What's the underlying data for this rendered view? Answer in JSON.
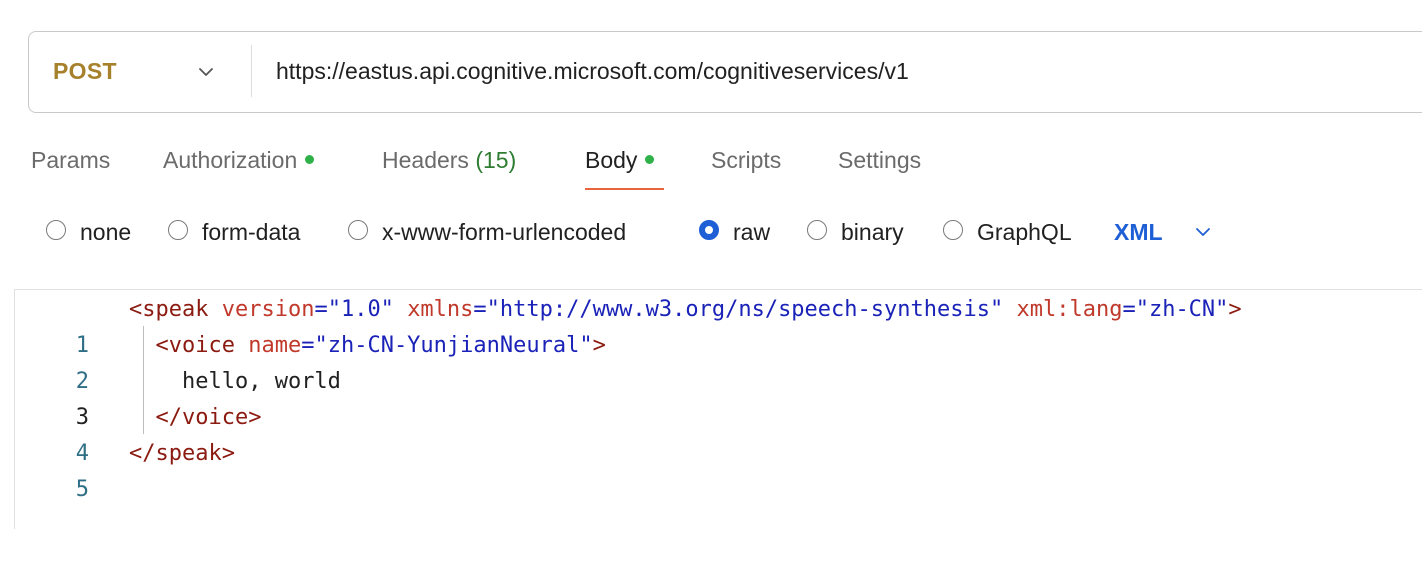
{
  "request": {
    "method": "POST",
    "url": "https://eastus.api.cognitive.microsoft.com/cognitiveservices/v1"
  },
  "tabs": [
    {
      "label": "Params"
    },
    {
      "label": "Authorization",
      "dot": true
    },
    {
      "label": "Headers",
      "count": "(15)"
    },
    {
      "label": "Body",
      "dot": true,
      "active": true
    },
    {
      "label": "Scripts"
    },
    {
      "label": "Settings"
    }
  ],
  "body_types": [
    {
      "label": "none",
      "selected": false
    },
    {
      "label": "form-data",
      "selected": false
    },
    {
      "label": "x-www-form-urlencoded",
      "selected": false
    },
    {
      "label": "raw",
      "selected": true
    },
    {
      "label": "binary",
      "selected": false
    },
    {
      "label": "GraphQL",
      "selected": false
    }
  ],
  "raw_language": "XML",
  "editor": {
    "line_numbers": [
      "1",
      "2",
      "3",
      "4",
      "5"
    ],
    "line1": {
      "open": "<speak",
      "attr1": "version",
      "val1": "\"1.0\"",
      "attr2": "xmlns",
      "val2": "\"http://www.w3.org/ns/speech-synthesis\"",
      "attr3": "xml:lang",
      "val3": "\"zh-CN\"",
      "close": ">"
    },
    "line2": {
      "open": "<voice",
      "attr1": "name",
      "val1": "\"zh-CN-YunjianNeural\"",
      "close": ">"
    },
    "line3": "hello, world",
    "line4": "</voice>",
    "line5": "</speak>",
    "eq": "="
  },
  "colors": {
    "method": "#a6802a",
    "active_tab_underline": "#e8663d",
    "status_dot": "#2fb14a",
    "accent_blue": "#1f5fd6",
    "xml_tag": "#8b1a10",
    "xml_attr": "#c0392b",
    "xml_value": "#1a22b8"
  }
}
